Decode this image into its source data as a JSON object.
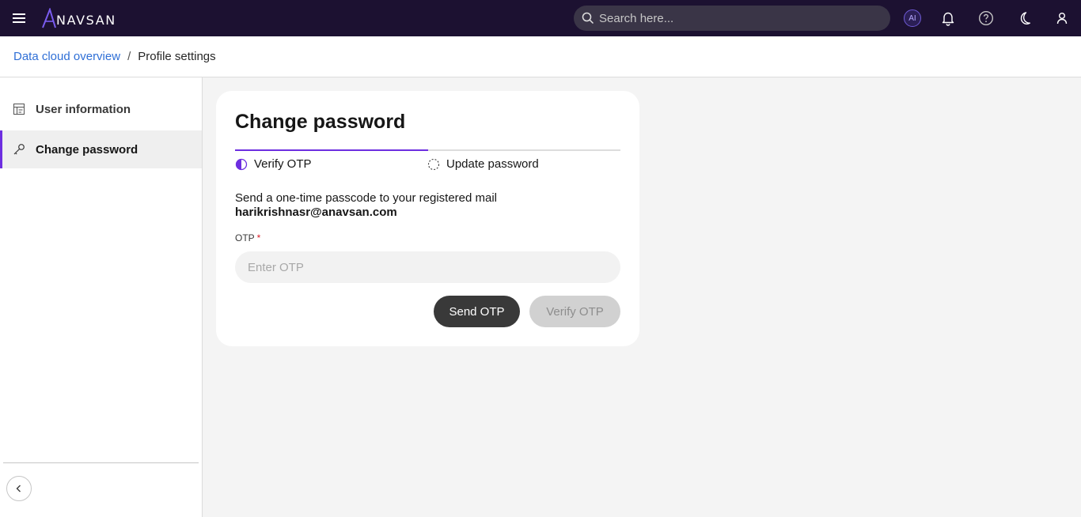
{
  "header": {
    "brand_initial": "A",
    "brand_rest": "NAVSAN",
    "search_placeholder": "Search here...",
    "ai_label": "AI",
    "icons": [
      "menu-icon",
      "search-icon",
      "ai-icon",
      "bell-icon",
      "help-icon",
      "moon-icon",
      "user-icon"
    ]
  },
  "breadcrumb": {
    "parent": "Data cloud overview",
    "separator": "/",
    "current": "Profile settings"
  },
  "sidebar": {
    "items": [
      {
        "label": "User information",
        "icon": "user-info-icon",
        "active": false
      },
      {
        "label": "Change password",
        "icon": "key-icon",
        "active": true
      }
    ],
    "collapse_icon": "chevron-left-icon"
  },
  "card": {
    "title": "Change password",
    "steps": [
      {
        "label": "Verify OTP",
        "state": "current"
      },
      {
        "label": "Update password",
        "state": "pending"
      }
    ],
    "progress_fraction": 0.5,
    "description": "Send a one-time passcode to your registered mail",
    "email": "harikrishnasr@anavsan.com",
    "otp_label": "OTP",
    "required_mark": "*",
    "otp_placeholder": "Enter OTP",
    "otp_value": "",
    "send_button": "Send OTP",
    "verify_button": "Verify OTP",
    "verify_disabled": true
  },
  "colors": {
    "topbar_bg": "#1c1131",
    "accent": "#6d2ee0",
    "link": "#2f6fd6",
    "primary_button": "#393939",
    "disabled_button": "#d1d1d1",
    "required": "#da1e28"
  }
}
